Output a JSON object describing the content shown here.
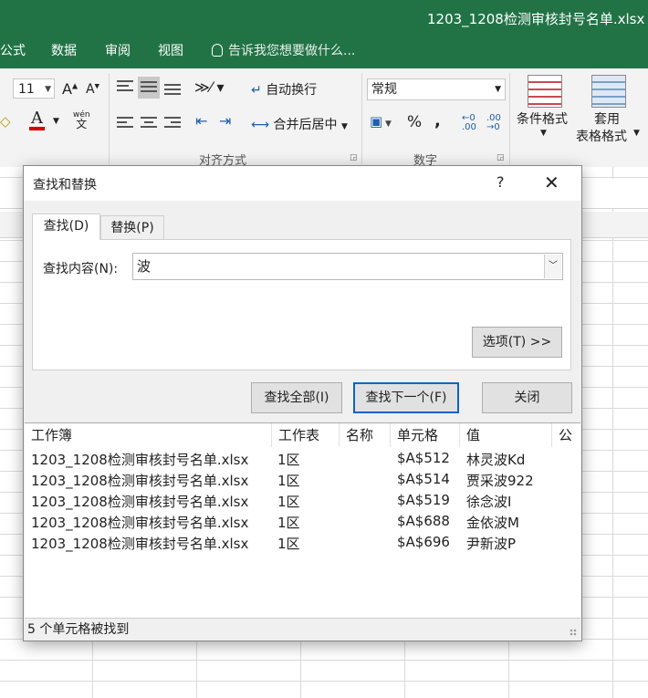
{
  "window": {
    "title": "1203_1208检测审核封号名单.xlsx -"
  },
  "ribbon_tabs": [
    "公式",
    "数据",
    "审阅",
    "视图"
  ],
  "tell_me": "告诉我您想要做什么...",
  "ribbon": {
    "font_size": "11",
    "wrap_text": "自动换行",
    "merge_center": "合并后居中",
    "number_format": "常规",
    "conditional_format": "条件格式",
    "table_format_line1": "套用",
    "table_format_line2": "表格格式",
    "group_alignment": "对齐方式",
    "group_number": "数字",
    "wen": "wén",
    "wen_char": "文",
    "percent": "%",
    "comma": ","
  },
  "dialog": {
    "title": "查找和替换",
    "help": "?",
    "close_glyph": "✕",
    "tabs": {
      "find": "查找(D)",
      "replace": "替换(P)"
    },
    "find_label": "查找内容(N):",
    "find_value": "波",
    "options_button": "选项(T) >>",
    "find_all_button": "查找全部(I)",
    "find_next_button": "查找下一个(F)",
    "close_button": "关闭",
    "results": {
      "columns": [
        "工作簿",
        "工作表",
        "名称",
        "单元格",
        "值",
        "公"
      ],
      "rows": [
        {
          "workbook": "1203_1208检测审核封号名单.xlsx",
          "sheet": "1区",
          "name": "",
          "cell": "$A$512",
          "value": "林灵波Kd"
        },
        {
          "workbook": "1203_1208检测审核封号名单.xlsx",
          "sheet": "1区",
          "name": "",
          "cell": "$A$514",
          "value": "贾采波922"
        },
        {
          "workbook": "1203_1208检测审核封号名单.xlsx",
          "sheet": "1区",
          "name": "",
          "cell": "$A$519",
          "value": "徐念波I"
        },
        {
          "workbook": "1203_1208检测审核封号名单.xlsx",
          "sheet": "1区",
          "name": "",
          "cell": "$A$688",
          "value": "金依波M"
        },
        {
          "workbook": "1203_1208检测审核封号名单.xlsx",
          "sheet": "1区",
          "name": "",
          "cell": "$A$696",
          "value": "尹新波P"
        }
      ]
    },
    "status": "5 个单元格被找到"
  },
  "colors": {
    "excel_green": "#217346",
    "default_button_border": "#0a64c8"
  }
}
